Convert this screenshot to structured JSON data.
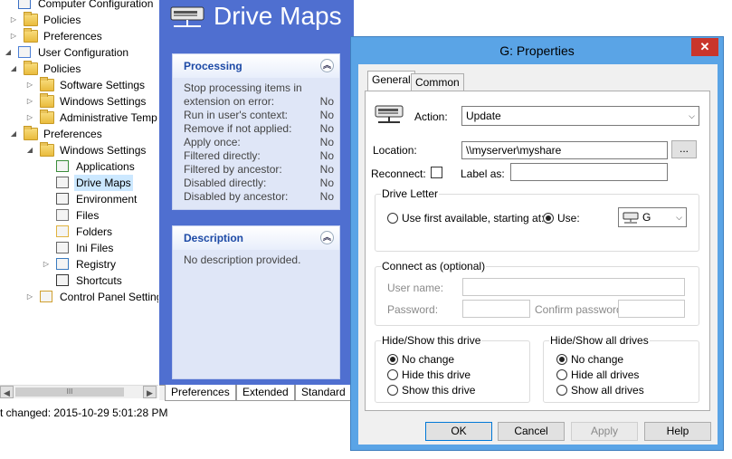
{
  "tree": {
    "items": [
      {
        "label": "Computer Configuration",
        "icon": "computer-icon",
        "arrow": "",
        "indent": 0
      },
      {
        "label": "Policies",
        "icon": "folder-icon",
        "arrow": "collapsed",
        "indent": 1
      },
      {
        "label": "Preferences",
        "icon": "folder-icon",
        "arrow": "collapsed",
        "indent": 1
      },
      {
        "label": "User Configuration",
        "icon": "user-icon",
        "arrow": "expanded",
        "indent": 0
      },
      {
        "label": "Policies",
        "icon": "folder-icon",
        "arrow": "expanded",
        "indent": 1
      },
      {
        "label": "Software Settings",
        "icon": "folder-icon",
        "arrow": "collapsed",
        "indent": 2
      },
      {
        "label": "Windows Settings",
        "icon": "folder-icon",
        "arrow": "collapsed",
        "indent": 2
      },
      {
        "label": "Administrative Temp",
        "icon": "folder-icon",
        "arrow": "collapsed",
        "indent": 2
      },
      {
        "label": "Preferences",
        "icon": "folder-icon",
        "arrow": "expanded",
        "indent": 1
      },
      {
        "label": "Windows Settings",
        "icon": "folder-icon",
        "arrow": "expanded",
        "indent": 2
      },
      {
        "label": "Applications",
        "icon": "applications-icon",
        "arrow": "",
        "indent": 3
      },
      {
        "label": "Drive Maps",
        "icon": "drive-icon",
        "arrow": "",
        "indent": 3,
        "selected": true
      },
      {
        "label": "Environment",
        "icon": "environment-icon",
        "arrow": "",
        "indent": 3
      },
      {
        "label": "Files",
        "icon": "files-icon",
        "arrow": "",
        "indent": 3
      },
      {
        "label": "Folders",
        "icon": "folders-icon",
        "arrow": "",
        "indent": 3
      },
      {
        "label": "Ini Files",
        "icon": "ini-files-icon",
        "arrow": "",
        "indent": 3
      },
      {
        "label": "Registry",
        "icon": "registry-icon",
        "arrow": "collapsed",
        "indent": 3
      },
      {
        "label": "Shortcuts",
        "icon": "shortcuts-icon",
        "arrow": "",
        "indent": 3
      },
      {
        "label": "Control Panel Setting",
        "icon": "control-panel-icon",
        "arrow": "collapsed",
        "indent": 2
      }
    ],
    "hscroll_thumb": "III"
  },
  "status_bar": {
    "text": "t changed: 2015-10-29 5:01:28 PM"
  },
  "center": {
    "title": "Drive Maps",
    "processing": {
      "header": "Processing",
      "rows": [
        {
          "label": "Stop processing items in",
          "value": ""
        },
        {
          "label": "extension on error:",
          "value": "No"
        },
        {
          "label": "Run in user's context:",
          "value": "No"
        },
        {
          "label": "Remove if not applied:",
          "value": "No"
        },
        {
          "label": "Apply once:",
          "value": "No"
        },
        {
          "label": "Filtered directly:",
          "value": "No"
        },
        {
          "label": "Filtered by ancestor:",
          "value": "No"
        },
        {
          "label": "Disabled directly:",
          "value": "No"
        },
        {
          "label": "Disabled by ancestor:",
          "value": "No"
        }
      ]
    },
    "description": {
      "header": "Description",
      "text": "No description provided."
    },
    "tabs": [
      "Preferences",
      "Extended",
      "Standard"
    ]
  },
  "dialog": {
    "title": "G: Properties",
    "close": "✕",
    "tabs": {
      "general": "General",
      "common": "Common"
    },
    "action_label": "Action:",
    "action_value": "Update",
    "location_label": "Location:",
    "location_value": "\\\\myserver\\myshare",
    "browse_label": "...",
    "reconnect_label": "Reconnect:",
    "reconnect_checked": false,
    "label_as_label": "Label as:",
    "label_as_value": "",
    "drive_letter": {
      "title": "Drive Letter",
      "first_available_label": "Use first available, starting at:",
      "use_label": "Use:",
      "use_value": "G",
      "selected": "use"
    },
    "connect_as": {
      "title": "Connect as (optional)",
      "user_name_label": "User name:",
      "password_label": "Password:",
      "confirm_password_label": "Confirm password:"
    },
    "hide_show_drive": {
      "title": "Hide/Show this drive",
      "options": [
        "No change",
        "Hide this drive",
        "Show this drive"
      ],
      "selected_index": 0
    },
    "hide_show_all": {
      "title": "Hide/Show all drives",
      "options": [
        "No change",
        "Hide all drives",
        "Show all drives"
      ],
      "selected_index": 0
    },
    "buttons": {
      "ok": "OK",
      "cancel": "Cancel",
      "apply": "Apply",
      "help": "Help"
    },
    "colors": {
      "titlebar": "#5aa4e6",
      "close": "#c9352b"
    }
  }
}
